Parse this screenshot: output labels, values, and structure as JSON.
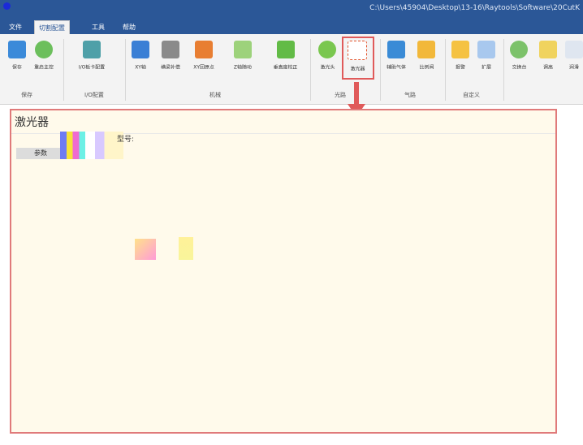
{
  "titlebar": {
    "path": "C:\\Users\\45904\\Desktop\\13-16\\Raytools\\Software\\20CutK"
  },
  "menu": {
    "tabs": [
      {
        "label": "文件"
      },
      {
        "label": "切割配置"
      },
      {
        "label": "工具"
      },
      {
        "label": "帮助"
      }
    ]
  },
  "ribbon": {
    "buttons": [
      {
        "label": "保存"
      },
      {
        "label": "重启主控"
      },
      {
        "label": "I/O板卡配置"
      },
      {
        "label": "XY轴"
      },
      {
        "label": "横梁补偿"
      },
      {
        "label": "XY回原点"
      },
      {
        "label": "Z轴随动"
      },
      {
        "label": "垂直度校正"
      },
      {
        "label": "激光头"
      },
      {
        "label": "激光器"
      },
      {
        "label": "辅助气体"
      },
      {
        "label": "比例阀"
      },
      {
        "label": "报警"
      },
      {
        "label": "扩展"
      },
      {
        "label": "交换台"
      },
      {
        "label": "调高"
      },
      {
        "label": "润滑"
      }
    ],
    "groups": [
      {
        "label": "保存"
      },
      {
        "label": "I/O配置"
      },
      {
        "label": "机械"
      },
      {
        "label": "光路"
      },
      {
        "label": "气路"
      },
      {
        "label": "自定义"
      }
    ]
  },
  "panel": {
    "title": "激光器",
    "tab": "参数",
    "garbled": "型号:"
  },
  "colors": {
    "title_bg": "#2b5797",
    "highlight": "#e05a5a",
    "panel_bg": "#fffaeb"
  }
}
